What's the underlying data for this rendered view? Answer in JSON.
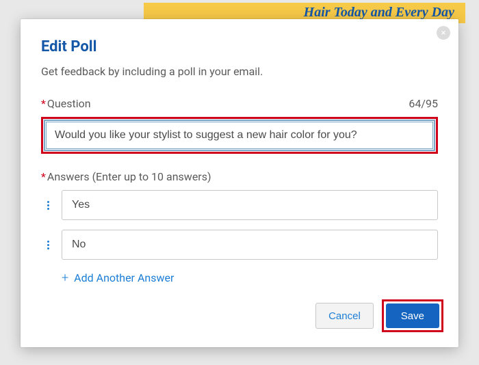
{
  "backdrop": {
    "banner_text": "Hair Today and Every Day"
  },
  "modal": {
    "title": "Edit Poll",
    "subtitle": "Get feedback by including a poll in your email.",
    "question": {
      "label": "Question",
      "counter": "64/95",
      "value": "Would you like your stylist to suggest a new hair color for you?"
    },
    "answers": {
      "label": "Answers (Enter up to 10 answers)",
      "items": [
        {
          "value": "Yes"
        },
        {
          "value": "No"
        }
      ],
      "add_label": "Add Another Answer"
    },
    "buttons": {
      "cancel": "Cancel",
      "save": "Save"
    },
    "close_glyph": "×"
  }
}
